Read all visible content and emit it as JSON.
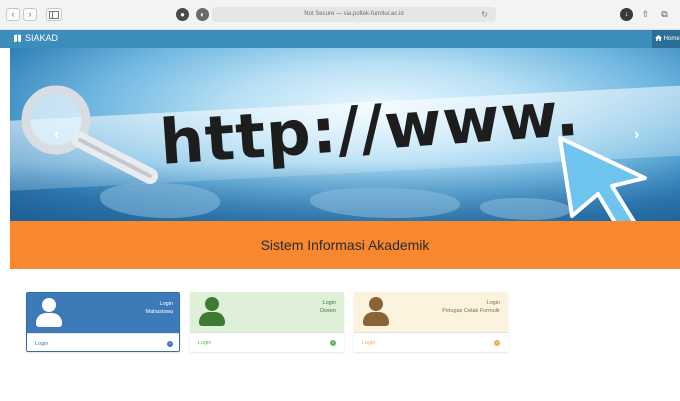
{
  "browser": {
    "address": "Not Secure — sia.poltek-furnitur.ac.id",
    "back_glyph": "‹",
    "forward_glyph": "›",
    "reload_glyph": "↻",
    "share_glyph": "⇧",
    "tabs_glyph": "⧉",
    "download_glyph": "↓"
  },
  "navbar": {
    "brand": "SIAKAD",
    "brand_icon": "book-icon",
    "home_label": "Home",
    "home_icon": "home-icon",
    "color": "#3c8dbc"
  },
  "carousel": {
    "url_text": "http://www.",
    "prev_glyph": "‹",
    "next_glyph": "›"
  },
  "banner": {
    "title": "Sistem Informasi Akademik",
    "color": "#f7882f"
  },
  "login_boxes": [
    {
      "line1": "Login",
      "line2": "Mahasiswa",
      "footer": "Login",
      "icon": "user-icon",
      "color": "#3c7ab8"
    },
    {
      "line1": "Login",
      "line2": "Dosen",
      "footer": "Login",
      "icon": "user-icon",
      "color": "#dff0d8"
    },
    {
      "line1": "Login",
      "line2": "Petugas Cetak Formulir",
      "footer": "Login",
      "icon": "user-icon",
      "color": "#fcf3df"
    }
  ]
}
